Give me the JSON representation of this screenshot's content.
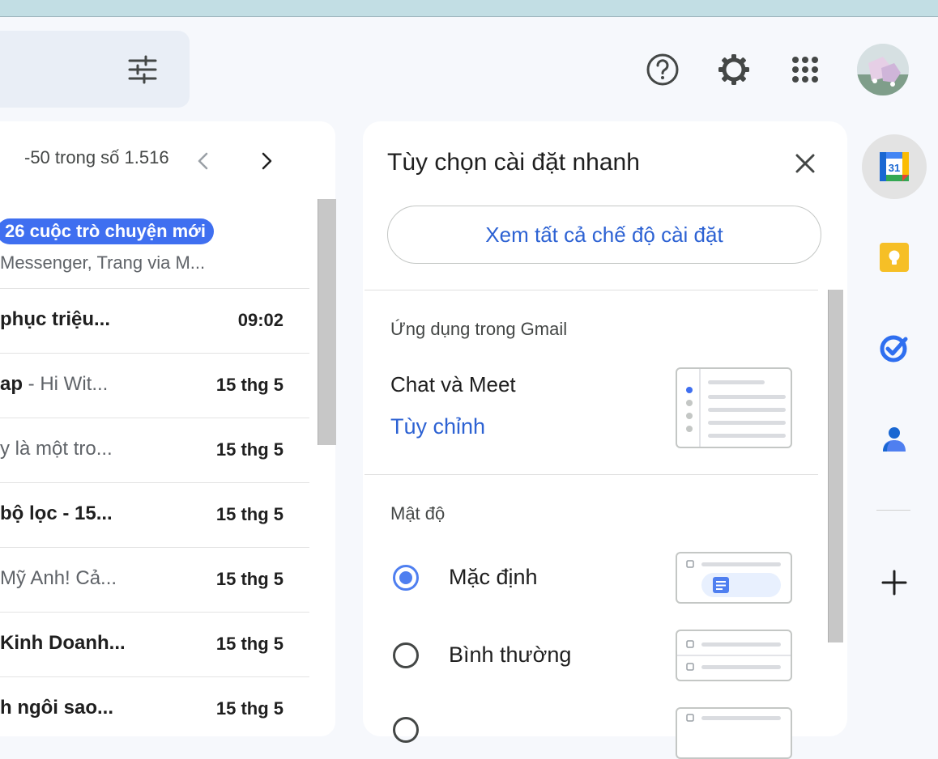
{
  "header": {
    "icons": [
      "tune-icon",
      "help-icon",
      "gear-icon",
      "apps-grid-icon",
      "avatar"
    ]
  },
  "email_list": {
    "pager_text": "-50 trong số 1.516",
    "promo": {
      "badge": "26 cuộc trò chuyện mới",
      "senders": "Messenger, Trang via M..."
    },
    "rows": [
      {
        "subject": "phục triệu...",
        "snippet": "",
        "time": "09:02",
        "bold": true
      },
      {
        "subject": "ap",
        "snippet": " - Hi Wit...",
        "time": "15 thg 5",
        "bold": true
      },
      {
        "subject": "y là một tro...",
        "snippet": "",
        "time": "15 thg 5",
        "bold": false
      },
      {
        "subject": "bộ lọc - 15...",
        "snippet": "",
        "time": "15 thg 5",
        "bold": true
      },
      {
        "subject": "Mỹ Anh! Cả...",
        "snippet": "",
        "time": "15 thg 5",
        "bold": false
      },
      {
        "subject": "Kinh Doanh...",
        "snippet": "",
        "time": "15 thg 5",
        "bold": true
      },
      {
        "subject": "h ngôi sao...",
        "snippet": "",
        "time": "15 thg 5",
        "bold": true
      }
    ]
  },
  "quick_settings": {
    "title": "Tùy chọn cài đặt nhanh",
    "see_all_button": "Xem tất cả chế độ cài đặt",
    "apps_section": {
      "heading": "Ứng dụng trong Gmail",
      "item_label": "Chat và Meet",
      "customize_link": "Tùy chỉnh"
    },
    "density_section": {
      "heading": "Mật độ",
      "options": [
        {
          "label": "Mặc định",
          "selected": true
        },
        {
          "label": "Bình thường",
          "selected": false
        }
      ]
    }
  },
  "side_rail": {
    "calendar_day": "31",
    "icons": [
      "calendar-icon",
      "keep-icon",
      "tasks-icon",
      "contacts-icon",
      "add-icon"
    ]
  },
  "colors": {
    "accent_blue": "#2d62d3",
    "radio_blue": "#4f7ff0",
    "keep_yellow": "#f6bf26",
    "background": "#f6f8fc"
  }
}
